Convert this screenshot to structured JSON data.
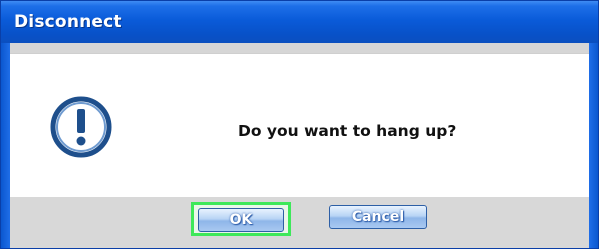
{
  "window": {
    "title": "Disconnect"
  },
  "dialog": {
    "icon": "exclamation-icon",
    "message": "Do you want to hang up?"
  },
  "buttons": {
    "ok_label": "OK",
    "cancel_label": "Cancel"
  },
  "colors": {
    "titlebar": "#0a5bd9",
    "focus_ring": "#3ee85a",
    "button": "#a9c9f1"
  }
}
